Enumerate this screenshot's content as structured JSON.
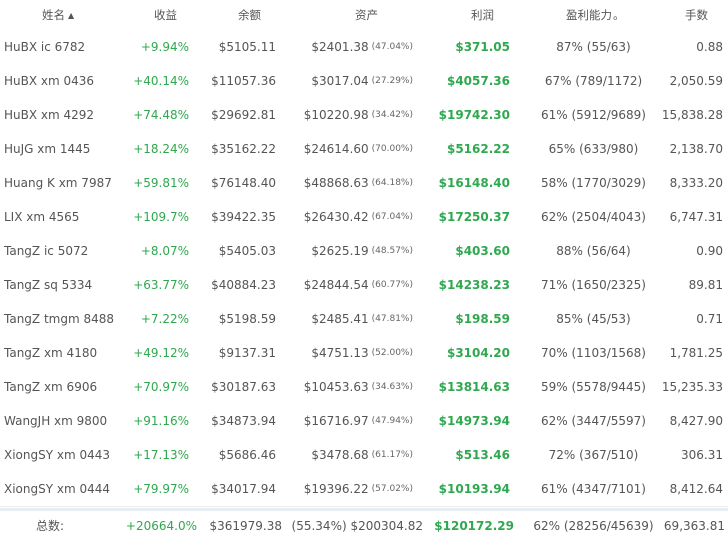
{
  "header": {
    "name": "姓名",
    "sort_icon": "sort-ascending-icon",
    "return": "收益",
    "balance": "余额",
    "assets": "资产",
    "profit": "利润",
    "win_rate": "盈利能力",
    "lots": "手数"
  },
  "rows": [
    {
      "name": "HuBX ic 6782",
      "return": "+9.94%",
      "balance": "$5105.11",
      "assets": "$2401.38",
      "assets_pct": "(47.04%)",
      "profit": "$371.05",
      "win_rate": "87% (55/63)",
      "lots": "0.88"
    },
    {
      "name": "HuBX xm 0436",
      "return": "+40.14%",
      "balance": "$11057.36",
      "assets": "$3017.04",
      "assets_pct": "(27.29%)",
      "profit": "$4057.36",
      "win_rate": "67% (789/1172)",
      "lots": "2,050.59"
    },
    {
      "name": "HuBX xm 4292",
      "return": "+74.48%",
      "balance": "$29692.81",
      "assets": "$10220.98",
      "assets_pct": "(34.42%)",
      "profit": "$19742.30",
      "win_rate": "61% (5912/9689)",
      "lots": "15,838.28"
    },
    {
      "name": "HuJG xm 1445",
      "return": "+18.24%",
      "balance": "$35162.22",
      "assets": "$24614.60",
      "assets_pct": "(70.00%)",
      "profit": "$5162.22",
      "win_rate": "65% (633/980)",
      "lots": "2,138.70"
    },
    {
      "name": "Huang K xm 7987",
      "return": "+59.81%",
      "balance": "$76148.40",
      "assets": "$48868.63",
      "assets_pct": "(64.18%)",
      "profit": "$16148.40",
      "win_rate": "58% (1770/3029)",
      "lots": "8,333.20"
    },
    {
      "name": "LIX xm 4565",
      "return": "+109.7%",
      "balance": "$39422.35",
      "assets": "$26430.42",
      "assets_pct": "(67.04%)",
      "profit": "$17250.37",
      "win_rate": "62% (2504/4043)",
      "lots": "6,747.31"
    },
    {
      "name": "TangZ ic 5072",
      "return": "+8.07%",
      "balance": "$5405.03",
      "assets": "$2625.19",
      "assets_pct": "(48.57%)",
      "profit": "$403.60",
      "win_rate": "88% (56/64)",
      "lots": "0.90"
    },
    {
      "name": "TangZ sq 5334",
      "return": "+63.77%",
      "balance": "$40884.23",
      "assets": "$24844.54",
      "assets_pct": "(60.77%)",
      "profit": "$14238.23",
      "win_rate": "71% (1650/2325)",
      "lots": "89.81"
    },
    {
      "name": "TangZ tmgm 8488",
      "return": "+7.22%",
      "balance": "$5198.59",
      "assets": "$2485.41",
      "assets_pct": "(47.81%)",
      "profit": "$198.59",
      "win_rate": "85% (45/53)",
      "lots": "0.71"
    },
    {
      "name": "TangZ xm 4180",
      "return": "+49.12%",
      "balance": "$9137.31",
      "assets": "$4751.13",
      "assets_pct": "(52.00%)",
      "profit": "$3104.20",
      "win_rate": "70% (1103/1568)",
      "lots": "1,781.25"
    },
    {
      "name": "TangZ xm 6906",
      "return": "+70.97%",
      "balance": "$30187.63",
      "assets": "$10453.63",
      "assets_pct": "(34.63%)",
      "profit": "$13814.63",
      "win_rate": "59% (5578/9445)",
      "lots": "15,235.33"
    },
    {
      "name": "WangJH xm 9800",
      "return": "+91.16%",
      "balance": "$34873.94",
      "assets": "$16716.97",
      "assets_pct": "(47.94%)",
      "profit": "$14973.94",
      "win_rate": "62% (3447/5597)",
      "lots": "8,427.90"
    },
    {
      "name": "XiongSY xm 0443",
      "return": "+17.13%",
      "balance": "$5686.46",
      "assets": "$3478.68",
      "assets_pct": "(61.17%)",
      "profit": "$513.46",
      "win_rate": "72% (367/510)",
      "lots": "306.31"
    },
    {
      "name": "XiongSY xm 0444",
      "return": "+79.97%",
      "balance": "$34017.94",
      "assets": "$19396.22",
      "assets_pct": "(57.02%)",
      "profit": "$10193.94",
      "win_rate": "61% (4347/7101)",
      "lots": "8,412.64"
    }
  ],
  "totals": {
    "label": "总数:",
    "return": "+20664.0%",
    "balance": "$361979.38",
    "assets": "(55.34%) $200304.82",
    "profit": "$120172.29",
    "win_rate": "62% (28256/45639)",
    "lots": "69,363.81"
  },
  "colors": {
    "positive": "#2fa84f",
    "border": "#ececec",
    "footer_separator": "#e6eef2"
  }
}
